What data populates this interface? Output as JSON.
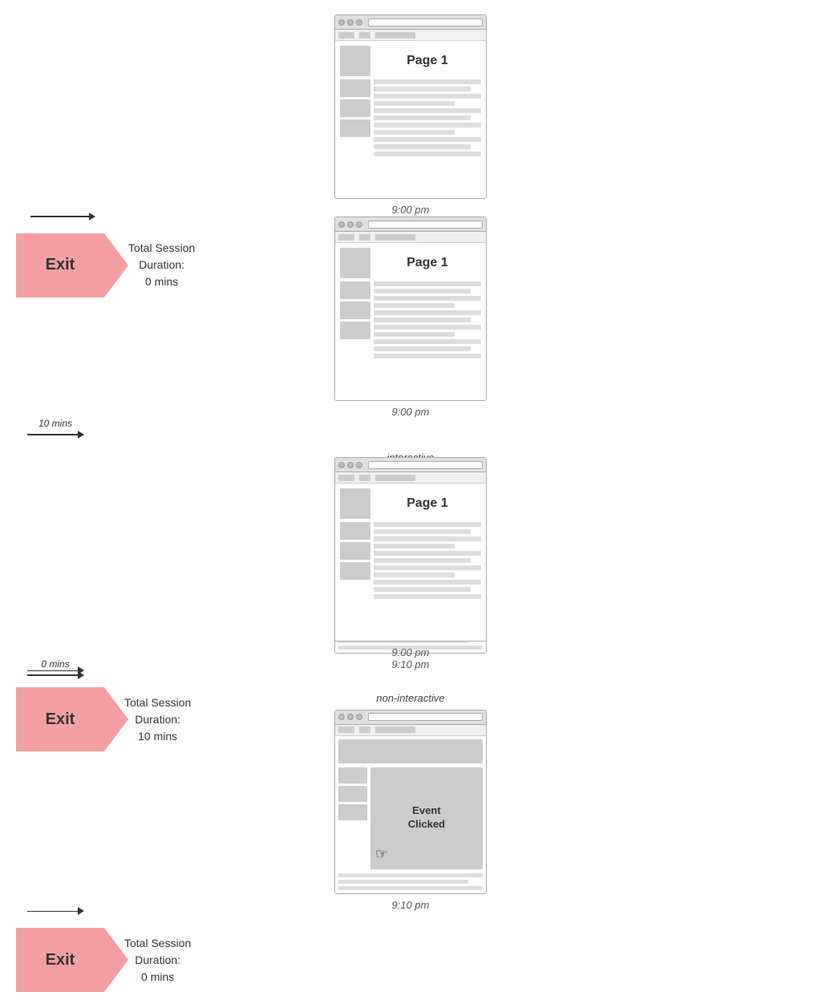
{
  "row1": {
    "page1_title": "Page 1",
    "timestamp1": "9:00 pm",
    "arrow_label": "",
    "exit_text": "Exit",
    "session_label": "Total Session\nDuration:\n0 mins"
  },
  "row2": {
    "page1_title": "Page 1",
    "timestamp1": "9:00 pm",
    "arrow_label": "10 mins",
    "browser_label": "interactive",
    "event_text_line1": "Event",
    "event_text_line2": "Clicked",
    "timestamp2": "9:10 pm",
    "exit_text": "Exit",
    "session_label": "Total Session\nDuration:\n10 mins"
  },
  "row3": {
    "page1_title": "Page 1",
    "timestamp1": "9:00 pm",
    "arrow_label": "0 mins",
    "browser_label": "non-interactive",
    "event_text_line1": "Event",
    "event_text_line2": "Clicked",
    "timestamp2": "9:10 pm",
    "exit_text": "Exit",
    "session_label": "Total Session\nDuration:\n0 mins"
  }
}
